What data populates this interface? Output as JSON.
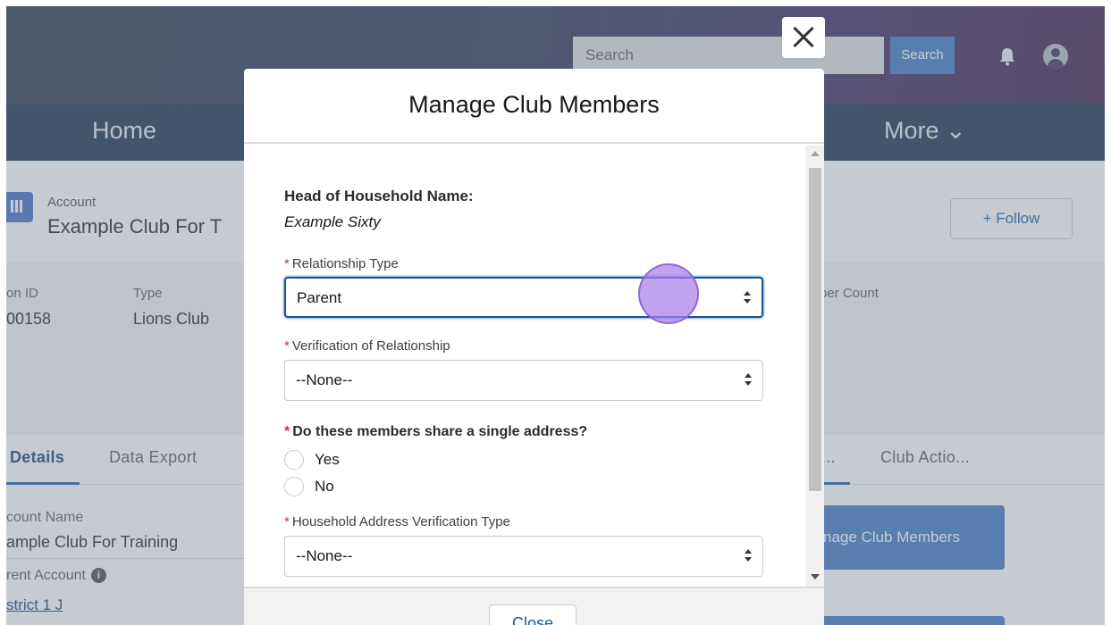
{
  "global_header": {
    "search_placeholder": "Search",
    "search_button": "Search"
  },
  "nav": {
    "home": "Home",
    "more": "More ⌄"
  },
  "record": {
    "object_label": "Account",
    "title": "Example Club For T",
    "follow_label": "+ Follow",
    "fields": {
      "id_label": "on ID",
      "id_value": "00158",
      "type_label": "Type",
      "type_value": "Lions Club",
      "count_label": "ber Count"
    }
  },
  "tabs": {
    "details": "Details",
    "data_export": "Data Export",
    "ellipsis": "...",
    "club_actions": "Club Actio..."
  },
  "details": {
    "account_name_label": "count Name",
    "account_name_value": "ample Club For Training",
    "parent_account_label": "rent Account",
    "parent_account_value": "strict 1 J",
    "info_glyph": "i"
  },
  "bg_actions": {
    "manage_members": "nage Club Members"
  },
  "modal": {
    "title": "Manage Club Members",
    "head_of_household_label": "Head of Household Name:",
    "head_of_household_value": "Example Sixty",
    "required_marker": "*",
    "relationship_type_label": "Relationship Type",
    "relationship_type_value": "Parent",
    "verification_label": "Verification of Relationship",
    "verification_value": "--None--",
    "share_address_label": "Do these members share a single address?",
    "share_address_options": [
      "Yes",
      "No"
    ],
    "address_verification_label": "Household Address Verification Type",
    "address_verification_value": "--None--",
    "close_button": "Close"
  },
  "colors": {
    "nav_bar": "#0f2848",
    "brand_blue": "#3a73c4",
    "focus_border": "#1b5297",
    "required": "#c23934",
    "click_marker": "#a87ee8"
  },
  "icons": [
    "bell-icon",
    "avatar-icon",
    "account-icon",
    "info-icon",
    "close-icon",
    "select-arrows-icon"
  ]
}
